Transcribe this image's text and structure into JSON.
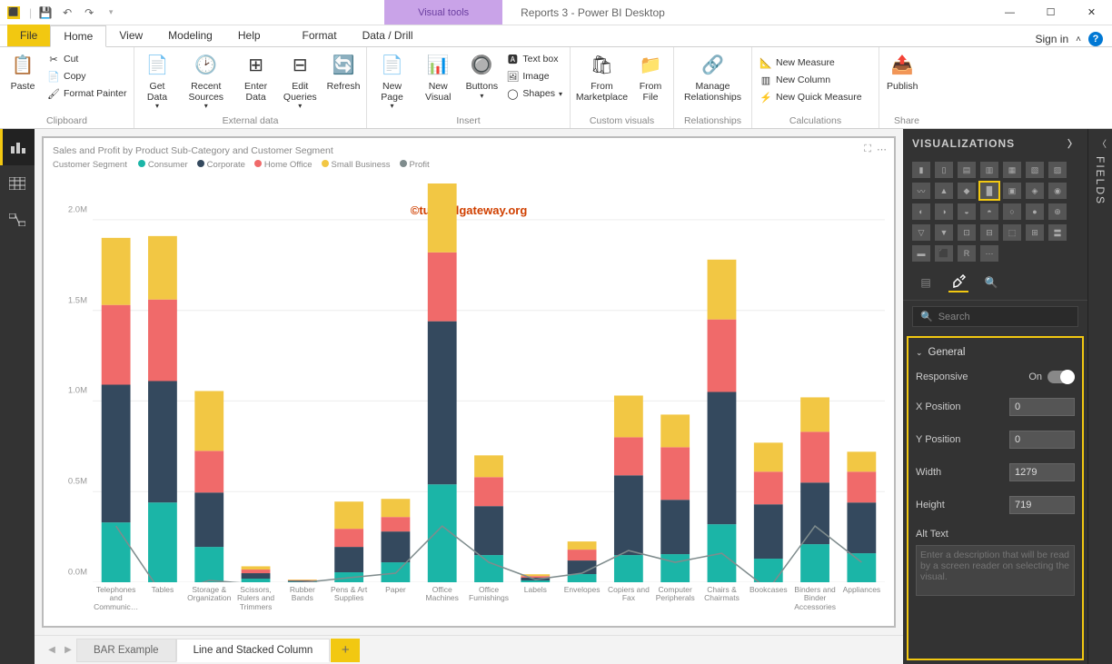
{
  "window": {
    "title": "Reports 3 - Power BI Desktop",
    "visual_tools": "Visual tools",
    "sign_in": "Sign in"
  },
  "tabs": {
    "file": "File",
    "home": "Home",
    "view": "View",
    "modeling": "Modeling",
    "help": "Help",
    "format": "Format",
    "datadrill": "Data / Drill"
  },
  "ribbon": {
    "clipboard": {
      "label": "Clipboard",
      "paste": "Paste",
      "cut": "Cut",
      "copy": "Copy",
      "fmt": "Format Painter"
    },
    "extdata": {
      "label": "External data",
      "getdata": "Get Data",
      "recent": "Recent Sources",
      "enter": "Enter Data",
      "edit": "Edit Queries",
      "refresh": "Refresh"
    },
    "insert": {
      "label": "Insert",
      "newpage": "New Page",
      "newvisual": "New Visual",
      "buttons": "Buttons",
      "textbox": "Text box",
      "image": "Image",
      "shapes": "Shapes"
    },
    "custom": {
      "label": "Custom visuals",
      "market": "From Marketplace",
      "file": "From File"
    },
    "rel": {
      "label": "Relationships",
      "manage": "Manage Relationships"
    },
    "calc": {
      "label": "Calculations",
      "measure": "New Measure",
      "column": "New Column",
      "quick": "New Quick Measure"
    },
    "share": {
      "label": "Share",
      "publish": "Publish"
    }
  },
  "chart": {
    "title": "Sales and Profit by Product Sub-Category and Customer Segment",
    "legend_label": "Customer Segment",
    "legend": [
      {
        "name": "Consumer",
        "color": "#1bb5a7"
      },
      {
        "name": "Corporate",
        "color": "#34495e"
      },
      {
        "name": "Home Office",
        "color": "#f06a6a"
      },
      {
        "name": "Small Business",
        "color": "#f2c744"
      },
      {
        "name": "Profit",
        "color": "#7f8c8d"
      }
    ],
    "watermark": "©tutorialgateway.org"
  },
  "chart_data": {
    "type": "bar",
    "title": "Sales and Profit by Product Sub-Category and Customer Segment",
    "ylabel": "",
    "xlabel": "",
    "ylim": [
      0,
      2200000
    ],
    "yticks": [
      "0.0M",
      "0.5M",
      "1.0M",
      "1.5M",
      "2.0M"
    ],
    "categories": [
      "Telephones and Communic…",
      "Tables",
      "Storage & Organization",
      "Scissors, Rulers and Trimmers",
      "Rubber Bands",
      "Pens & Art Supplies",
      "Paper",
      "Office Machines",
      "Office Furnishings",
      "Labels",
      "Envelopes",
      "Copiers and Fax",
      "Computer Peripherals",
      "Chairs & Chairmats",
      "Bookcases",
      "Binders and Binder Accessories",
      "Appliances"
    ],
    "series": [
      {
        "name": "Consumer",
        "color": "#1bb5a7",
        "values": [
          330000,
          440000,
          195000,
          20000,
          3000,
          55000,
          110000,
          540000,
          150000,
          10000,
          45000,
          150000,
          155000,
          320000,
          130000,
          210000,
          160000
        ]
      },
      {
        "name": "Corporate",
        "color": "#34495e",
        "values": [
          760000,
          670000,
          300000,
          30000,
          6000,
          140000,
          170000,
          900000,
          270000,
          15000,
          75000,
          440000,
          300000,
          730000,
          300000,
          340000,
          280000
        ]
      },
      {
        "name": "Home Office",
        "color": "#f06a6a",
        "values": [
          440000,
          450000,
          230000,
          20000,
          2500,
          100000,
          80000,
          380000,
          160000,
          9000,
          60000,
          210000,
          290000,
          400000,
          180000,
          280000,
          170000
        ]
      },
      {
        "name": "Small Business",
        "color": "#f2c744",
        "values": [
          370000,
          350000,
          330000,
          18000,
          3500,
          150000,
          100000,
          380000,
          120000,
          10000,
          45000,
          230000,
          180000,
          330000,
          160000,
          190000,
          110000
        ]
      }
    ],
    "profit_line": [
      310000,
      -70000,
      10000,
      -10000,
      -2000,
      25000,
      50000,
      310000,
      110000,
      15000,
      50000,
      175000,
      110000,
      160000,
      -40000,
      310000,
      110000
    ]
  },
  "pagetabs": {
    "bar": "BAR Example",
    "line": "Line and Stacked Column"
  },
  "viz": {
    "header": "VISUALIZATIONS",
    "fields": "FIELDS",
    "search": "Search",
    "general": {
      "label": "General",
      "responsive": {
        "label": "Responsive",
        "state": "On"
      },
      "xpos": {
        "label": "X Position",
        "value": "0"
      },
      "ypos": {
        "label": "Y Position",
        "value": "0"
      },
      "width": {
        "label": "Width",
        "value": "1279"
      },
      "height": {
        "label": "Height",
        "value": "719"
      },
      "alt": {
        "label": "Alt Text",
        "placeholder": "Enter a description that will be read by a screen reader on selecting the visual."
      }
    }
  }
}
